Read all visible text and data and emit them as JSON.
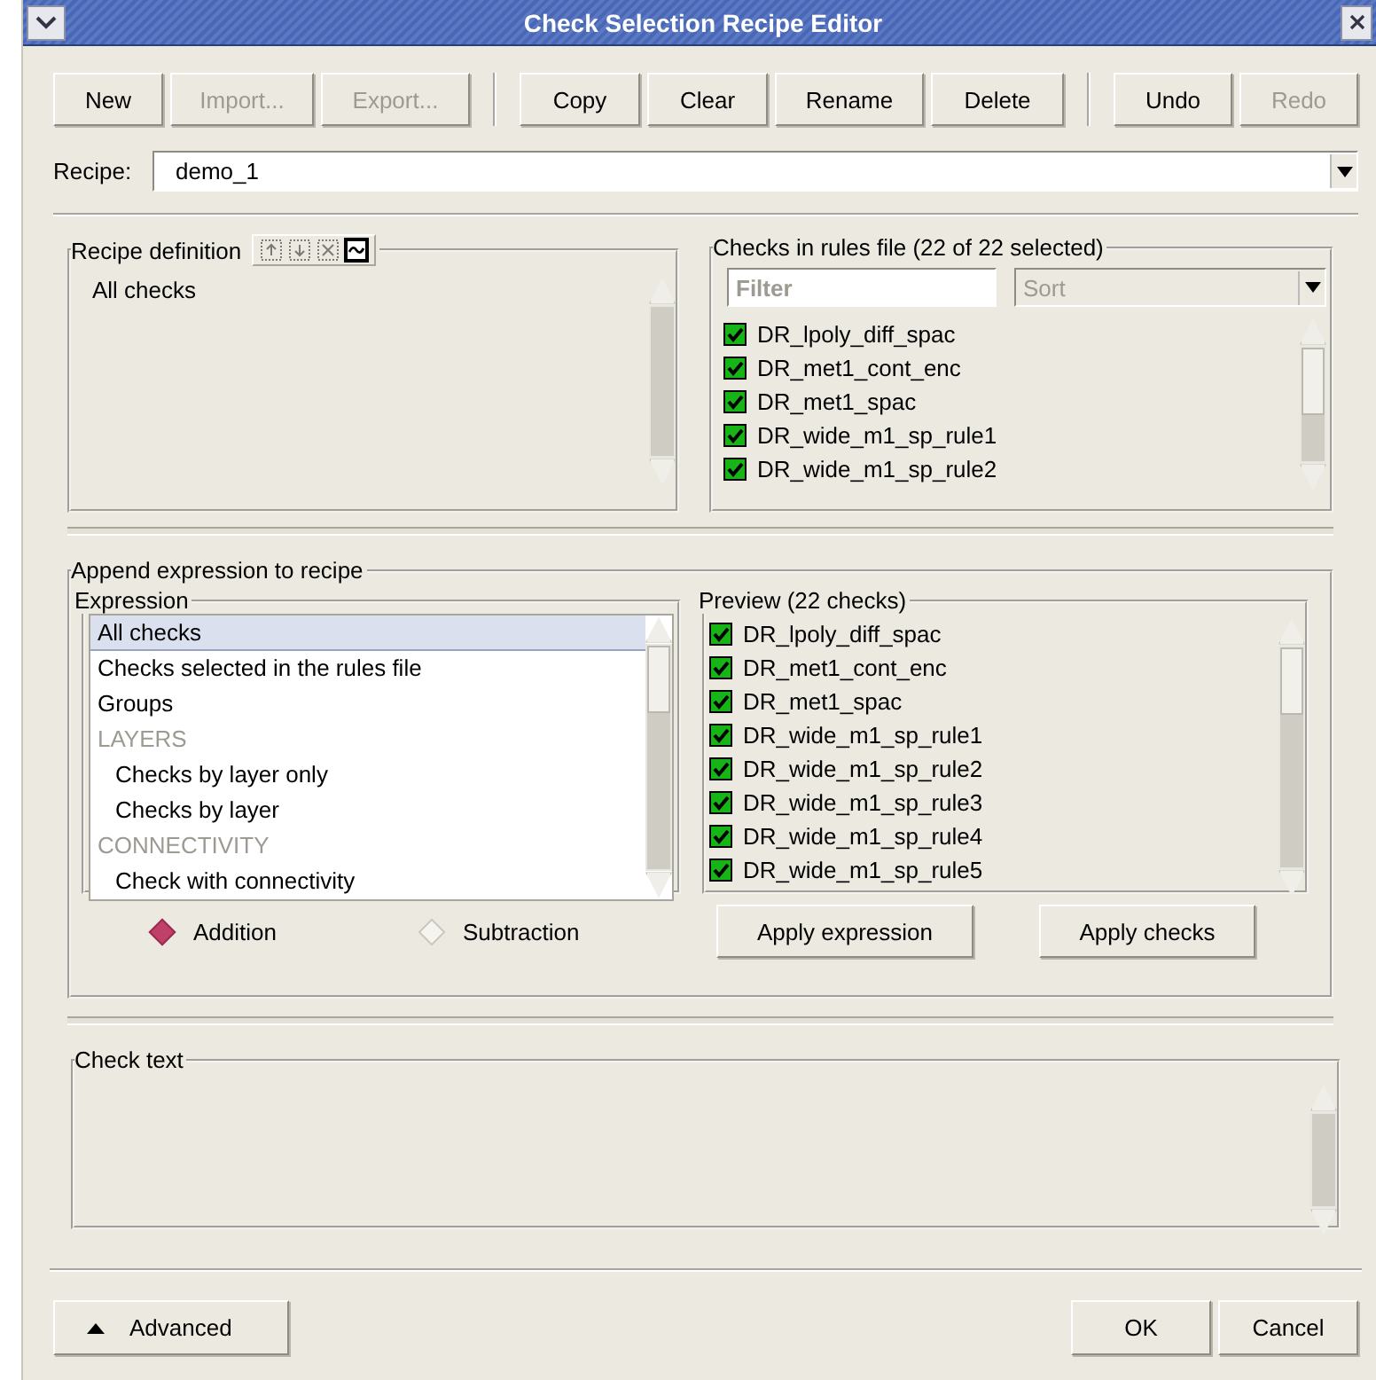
{
  "window": {
    "title": "Check Selection Recipe Editor"
  },
  "toolbar": {
    "groups": [
      {
        "buttons": [
          {
            "label": "New",
            "disabled": false
          },
          {
            "label": "Import...",
            "disabled": true
          },
          {
            "label": "Export...",
            "disabled": true
          }
        ]
      },
      {
        "buttons": [
          {
            "label": "Copy",
            "disabled": false
          },
          {
            "label": "Clear",
            "disabled": false
          },
          {
            "label": "Rename",
            "disabled": false
          },
          {
            "label": "Delete",
            "disabled": false
          }
        ]
      },
      {
        "buttons": [
          {
            "label": "Undo",
            "disabled": false
          },
          {
            "label": "Redo",
            "disabled": true
          }
        ]
      }
    ]
  },
  "recipe": {
    "label": "Recipe:",
    "value": "demo_1"
  },
  "recipe_definition": {
    "title": "Recipe definition",
    "tools": [
      {
        "kind": "up",
        "disabled": true
      },
      {
        "kind": "down",
        "disabled": true
      },
      {
        "kind": "delete",
        "disabled": true
      },
      {
        "kind": "wave",
        "disabled": false
      }
    ],
    "items": [
      "All checks"
    ]
  },
  "rules_checks": {
    "title": "Checks in rules file (22 of 22 selected)",
    "filter": {
      "placeholder": "Filter"
    },
    "sort": {
      "value": "Sort",
      "disabled": true
    },
    "items": [
      {
        "label": "DR_lpoly_diff_spac",
        "checked": true
      },
      {
        "label": "DR_met1_cont_enc",
        "checked": true
      },
      {
        "label": "DR_met1_spac",
        "checked": true
      },
      {
        "label": "DR_wide_m1_sp_rule1",
        "checked": true
      },
      {
        "label": "DR_wide_m1_sp_rule2",
        "checked": true
      }
    ]
  },
  "append": {
    "title": "Append expression to recipe",
    "expression": {
      "title": "Expression",
      "items": [
        {
          "label": "All checks",
          "kind": "item",
          "selected": true
        },
        {
          "label": "Checks selected in the rules file",
          "kind": "item",
          "selected": false
        },
        {
          "label": "Groups",
          "kind": "item",
          "selected": false
        },
        {
          "label": "LAYERS",
          "kind": "header",
          "selected": false,
          "children": [
            {
              "label": "Checks by layer only",
              "kind": "item",
              "selected": false
            },
            {
              "label": "Checks by layer",
              "kind": "item",
              "selected": false
            }
          ]
        },
        {
          "label": "CONNECTIVITY",
          "kind": "header",
          "selected": false,
          "children": [
            {
              "label": "Check with connectivity",
              "kind": "item",
              "selected": false
            }
          ]
        }
      ]
    },
    "modes": [
      {
        "label": "Addition",
        "selected": true
      },
      {
        "label": "Subtraction",
        "selected": false
      }
    ],
    "preview": {
      "title": "Preview (22 checks)",
      "items": [
        {
          "label": "DR_lpoly_diff_spac",
          "checked": true
        },
        {
          "label": "DR_met1_cont_enc",
          "checked": true
        },
        {
          "label": "DR_met1_spac",
          "checked": true
        },
        {
          "label": "DR_wide_m1_sp_rule1",
          "checked": true
        },
        {
          "label": "DR_wide_m1_sp_rule2",
          "checked": true
        },
        {
          "label": "DR_wide_m1_sp_rule3",
          "checked": true
        },
        {
          "label": "DR_wide_m1_sp_rule4",
          "checked": true
        },
        {
          "label": "DR_wide_m1_sp_rule5",
          "checked": true
        }
      ]
    },
    "buttons": [
      "Apply expression",
      "Apply checks"
    ]
  },
  "check_text": {
    "title": "Check text"
  },
  "footer": {
    "advanced": "Advanced",
    "buttons": [
      "OK",
      "Cancel"
    ]
  }
}
